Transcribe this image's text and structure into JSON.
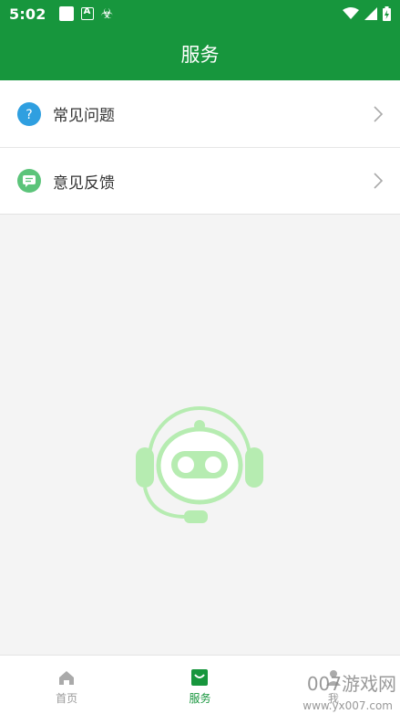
{
  "status_bar": {
    "time": "5:02",
    "icons": [
      "notification-square-icon",
      "a-app-icon",
      "bug-app-icon",
      "wifi-icon",
      "signal-icon",
      "battery-icon"
    ]
  },
  "header": {
    "title": "服务"
  },
  "menu": {
    "items": [
      {
        "label": "常见问题",
        "icon": "question-icon",
        "color": "#2f9fe0"
      },
      {
        "label": "意见反馈",
        "icon": "feedback-icon",
        "color": "#5cc47a"
      }
    ]
  },
  "tabbar": {
    "items": [
      {
        "label": "首页",
        "icon": "home-icon",
        "active": false
      },
      {
        "label": "服务",
        "icon": "shopping-bag-icon",
        "active": true
      },
      {
        "label": "我",
        "icon": "user-icon",
        "active": false
      }
    ]
  },
  "watermark": {
    "text": "007游戏网",
    "url": "www.yx007.com"
  },
  "colors": {
    "primary": "#17963d",
    "mascot": "#b6ecb1"
  }
}
